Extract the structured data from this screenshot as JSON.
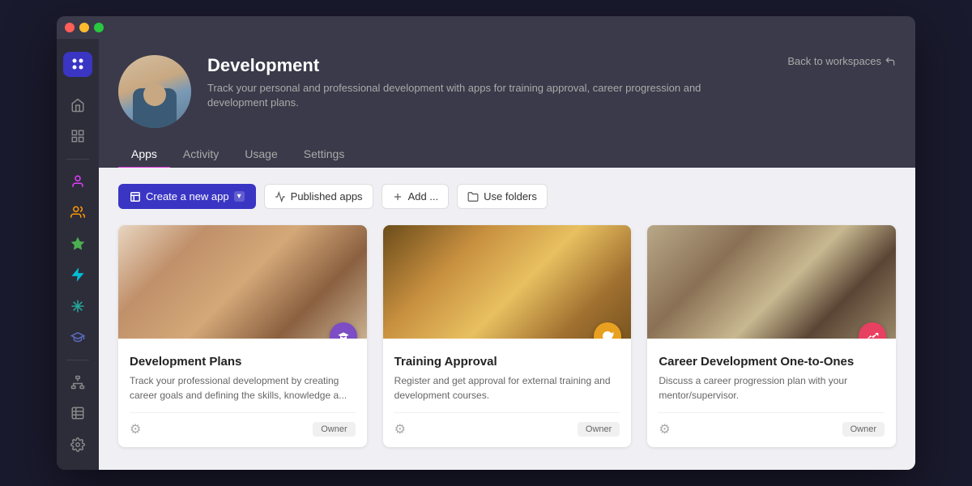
{
  "window": {
    "dots": [
      "red",
      "yellow",
      "green"
    ]
  },
  "sidebar": {
    "logo_icon": "grid-dots",
    "items": [
      {
        "id": "home",
        "icon": "⌂",
        "active": false
      },
      {
        "id": "dashboard",
        "icon": "⊞",
        "active": false
      },
      {
        "id": "person",
        "icon": "👤",
        "active": true,
        "color": "pink"
      },
      {
        "id": "users",
        "icon": "👥",
        "active": false,
        "color": "orange"
      },
      {
        "id": "star",
        "icon": "★",
        "active": false,
        "color": "green"
      },
      {
        "id": "lightning",
        "icon": "⚡",
        "active": false,
        "color": "cyan"
      },
      {
        "id": "asterisk",
        "icon": "✳",
        "active": false,
        "color": "teal"
      },
      {
        "id": "graduation",
        "icon": "🎓",
        "active": false,
        "color": "blue"
      },
      {
        "id": "hierarchy",
        "icon": "⋮",
        "active": false
      },
      {
        "id": "grid",
        "icon": "▦",
        "active": false
      },
      {
        "id": "settings",
        "icon": "⚙",
        "active": false
      }
    ]
  },
  "header": {
    "title": "Development",
    "description": "Track your personal and professional development with apps for training approval, career progression and development plans.",
    "back_link": "Back to workspaces",
    "tabs": [
      {
        "id": "apps",
        "label": "Apps",
        "active": true
      },
      {
        "id": "activity",
        "label": "Activity",
        "active": false
      },
      {
        "id": "usage",
        "label": "Usage",
        "active": false
      },
      {
        "id": "settings",
        "label": "Settings",
        "active": false
      }
    ]
  },
  "toolbar": {
    "create_label": "Create a new app",
    "published_label": "Published apps",
    "add_label": "Add ...",
    "folders_label": "Use folders"
  },
  "apps": [
    {
      "id": "dev-plans",
      "title": "Development Plans",
      "description": "Track your professional development by creating career goals and defining the skills, knowledge a...",
      "owner": "Owner",
      "badge_color": "purple"
    },
    {
      "id": "training-approval",
      "title": "Training Approval",
      "description": "Register and get approval for external training and development courses.",
      "owner": "Owner",
      "badge_color": "orange"
    },
    {
      "id": "career-dev",
      "title": "Career Development One-to-Ones",
      "description": "Discuss a career progression plan with your mentor/supervisor.",
      "owner": "Owner",
      "badge_color": "pink"
    }
  ]
}
